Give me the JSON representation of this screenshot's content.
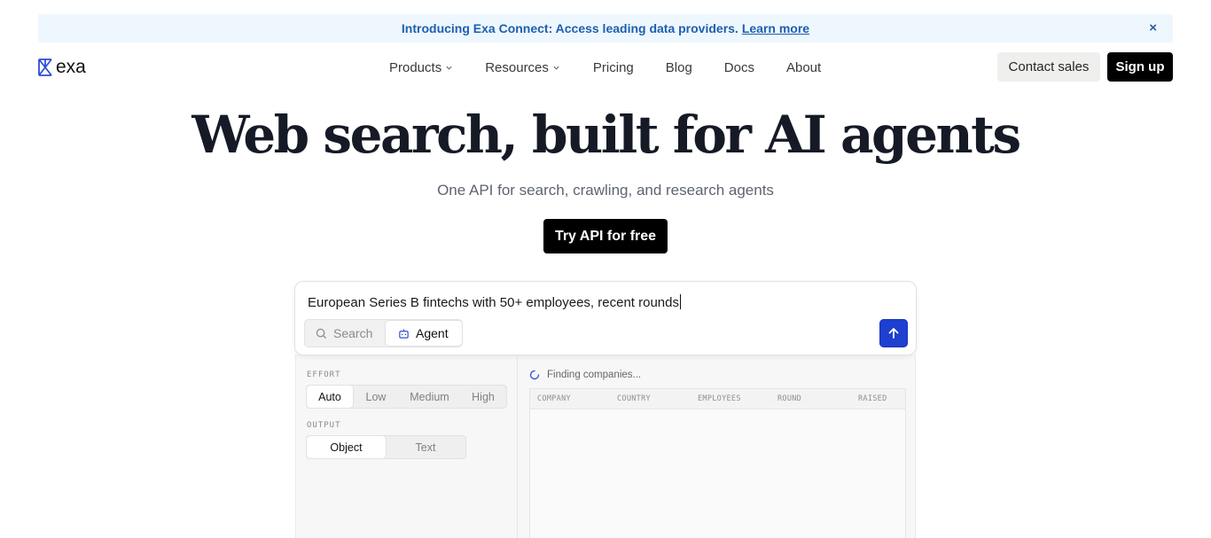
{
  "banner": {
    "text": "Introducing Exa Connect: Access leading data providers.",
    "link": "Learn more",
    "close_icon": "×"
  },
  "nav": {
    "logo_text": "exa",
    "menu": [
      {
        "label": "Products",
        "has_dropdown": true
      },
      {
        "label": "Resources",
        "has_dropdown": true
      },
      {
        "label": "Pricing",
        "has_dropdown": false
      },
      {
        "label": "Blog",
        "has_dropdown": false
      },
      {
        "label": "Docs",
        "has_dropdown": false
      },
      {
        "label": "About",
        "has_dropdown": false
      }
    ],
    "contact_label": "Contact sales",
    "signup_label": "Sign up"
  },
  "hero": {
    "title": "Web search, built for AI agents",
    "subtitle": "One API for search, crawling, and research agents",
    "cta_label": "Try API for free"
  },
  "search_card": {
    "query": "European Series B fintechs with 50+ employees, recent rounds",
    "modes": [
      {
        "label": "Search",
        "icon": "search-icon",
        "active": false
      },
      {
        "label": "Agent",
        "icon": "bot-icon",
        "active": true
      }
    ],
    "submit_icon": "arrow-up-icon"
  },
  "demo": {
    "effort_label": "EFFORT",
    "effort_options": [
      "Auto",
      "Low",
      "Medium",
      "High"
    ],
    "effort_selected": "Auto",
    "output_label": "OUTPUT",
    "output_options": [
      "Object",
      "Text"
    ],
    "output_selected": "Object",
    "status_text": "Finding companies...",
    "columns": [
      "COMPANY",
      "COUNTRY",
      "EMPLOYEES",
      "ROUND",
      "RAISED"
    ]
  },
  "colors": {
    "banner_bg": "#eef7fd",
    "banner_text": "#1d5fb0",
    "submit_bg": "#1f3fd1",
    "logo_accent": "#2e4fd6"
  }
}
